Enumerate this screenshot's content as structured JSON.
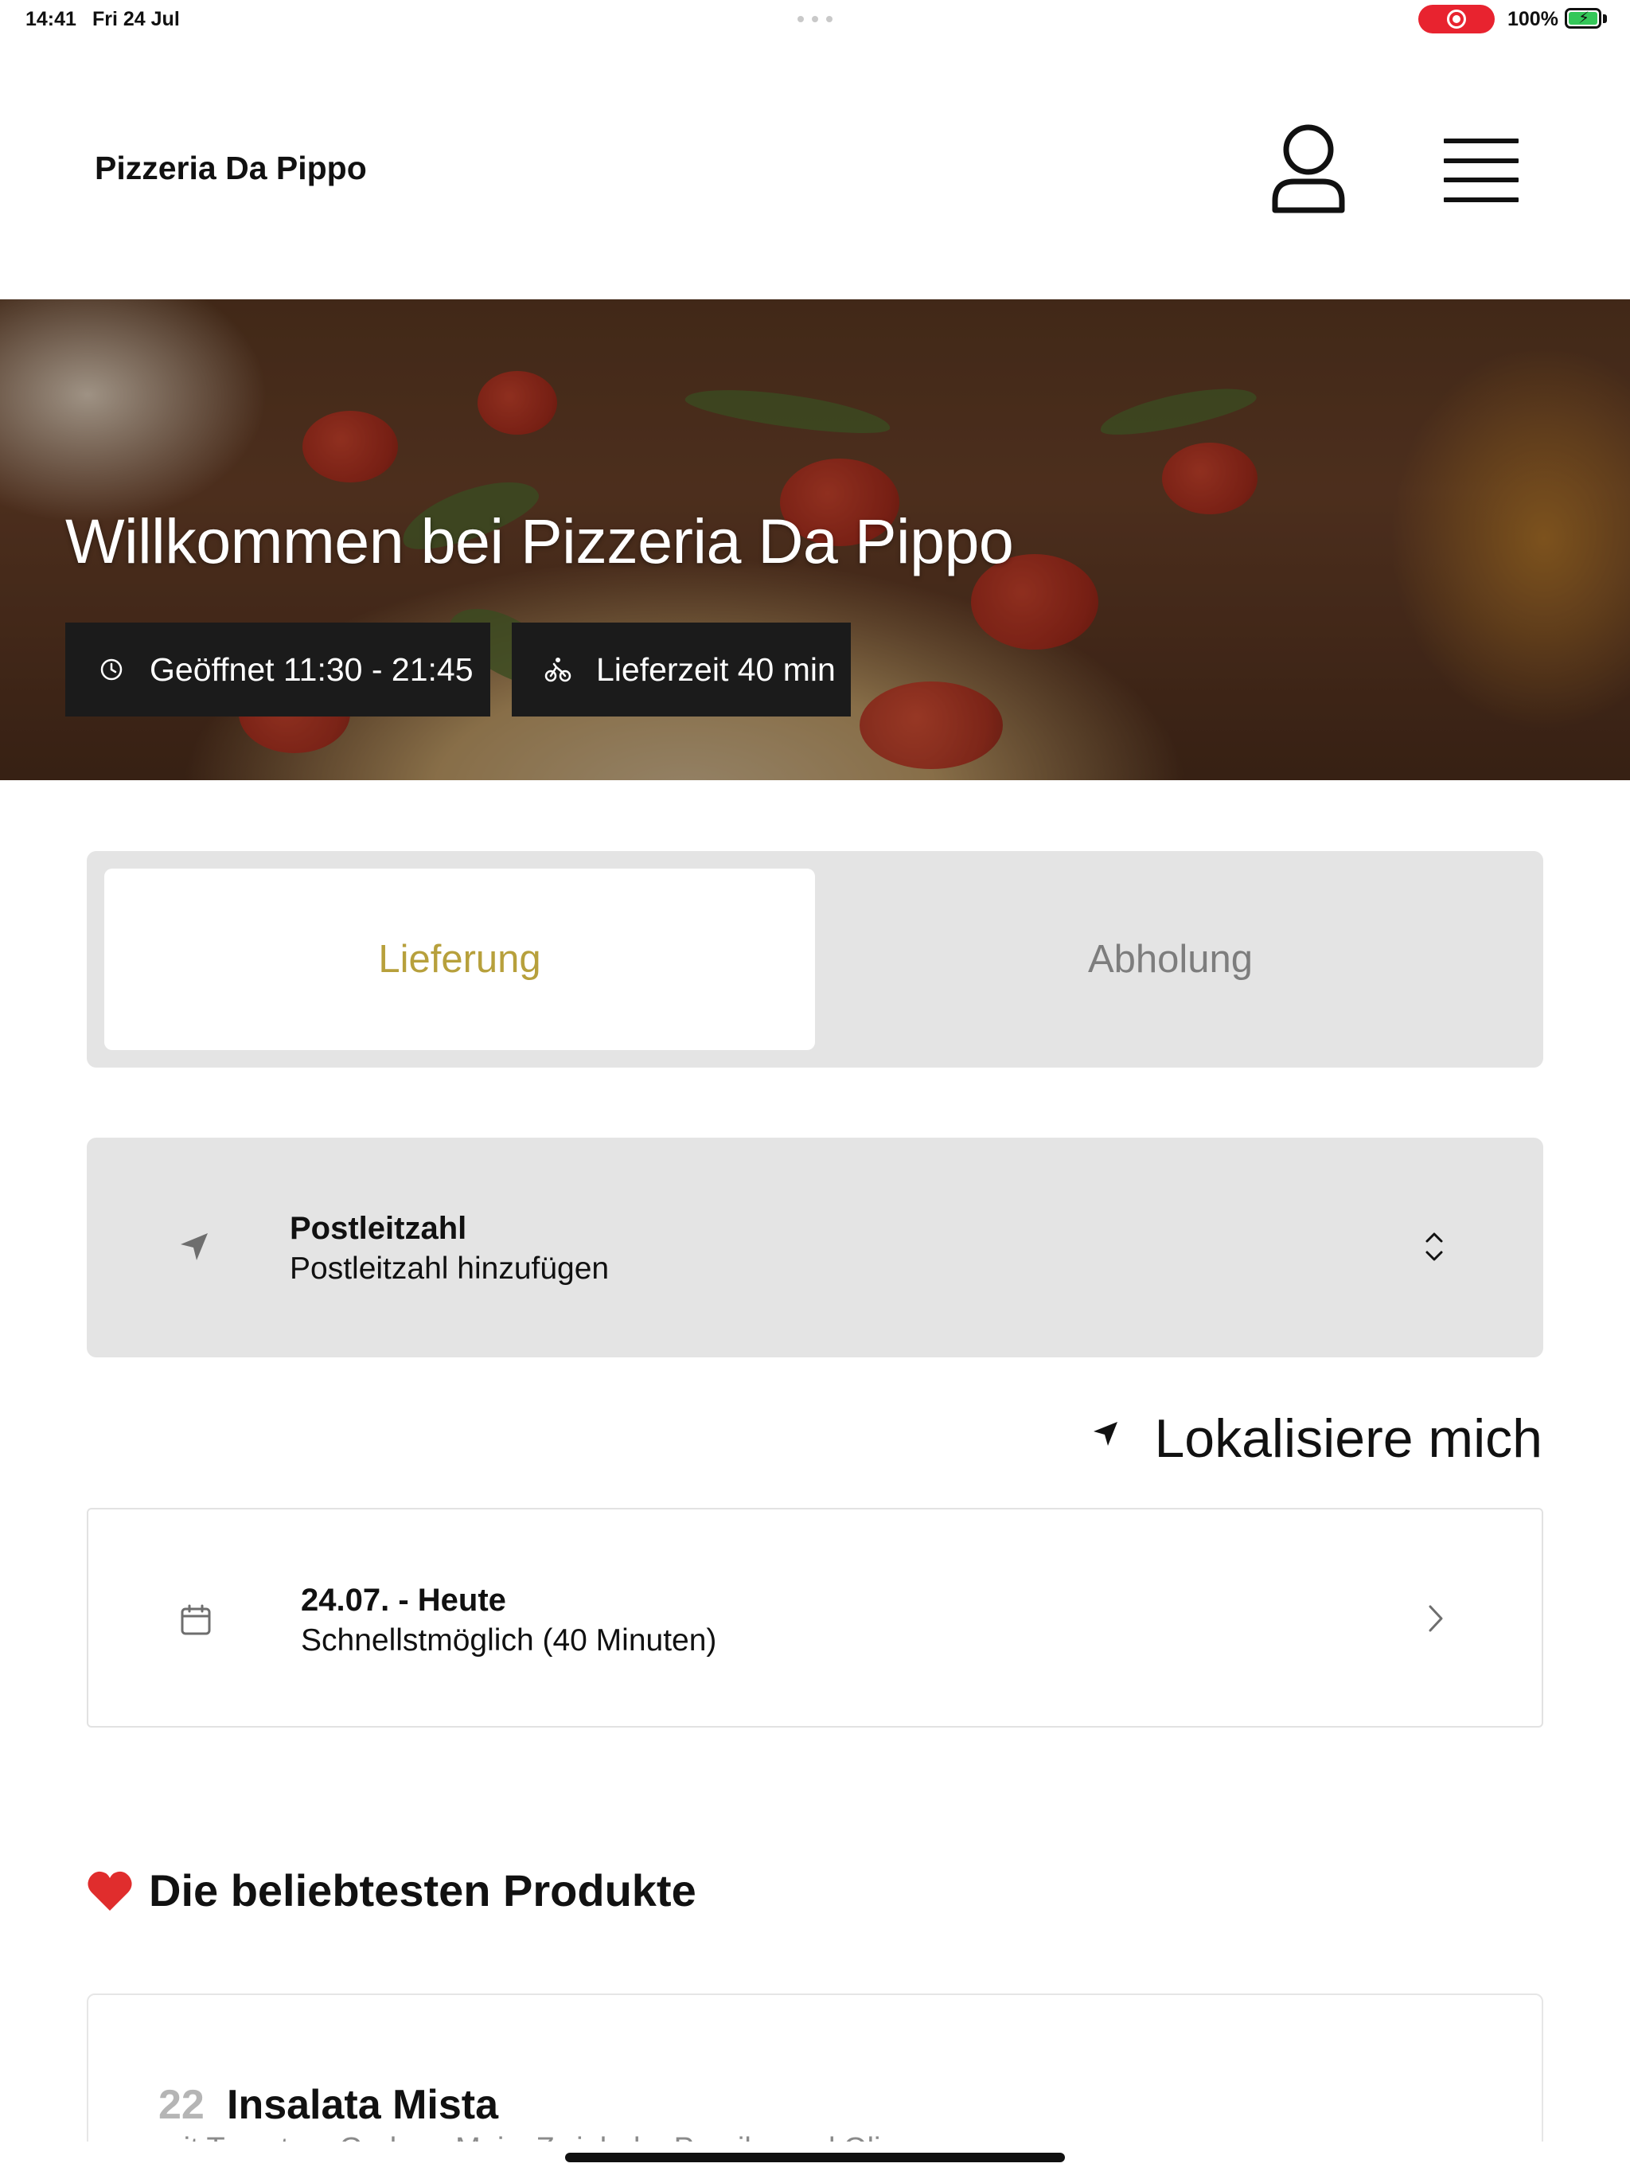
{
  "status_bar": {
    "time": "14:41",
    "date": "Fri 24 Jul",
    "battery": "100%"
  },
  "header": {
    "brand": "Pizzeria Da Pippo",
    "icons": [
      "user-icon",
      "hamburger-menu-icon"
    ]
  },
  "hero": {
    "title": "Willkommen bei Pizzeria Da Pippo",
    "opening_hours": "Geöffnet 11:30 - 21:45",
    "delivery_time": "Lieferzeit 40 min",
    "icons": [
      "clock-icon",
      "bicycle-icon"
    ]
  },
  "order_mode": {
    "active": "Lieferung",
    "inactive": "Abholung",
    "active_color": "#b7a03c"
  },
  "postal_code": {
    "label": "Postleitzahl",
    "placeholder": "Postleitzahl hinzufügen"
  },
  "locate_me": {
    "label": "Lokalisiere mich"
  },
  "delivery_date": {
    "title": "24.07. - Heute",
    "subtitle": "Schnellstmöglich (40 Minuten)"
  },
  "popular": {
    "title": "Die beliebtesten Produkte",
    "products": [
      {
        "number": "22",
        "name": "Insalata Mista",
        "description": "mit Tomaten, Gurken, Mais, Zwiebeln, Paprika und Oliven"
      }
    ]
  }
}
